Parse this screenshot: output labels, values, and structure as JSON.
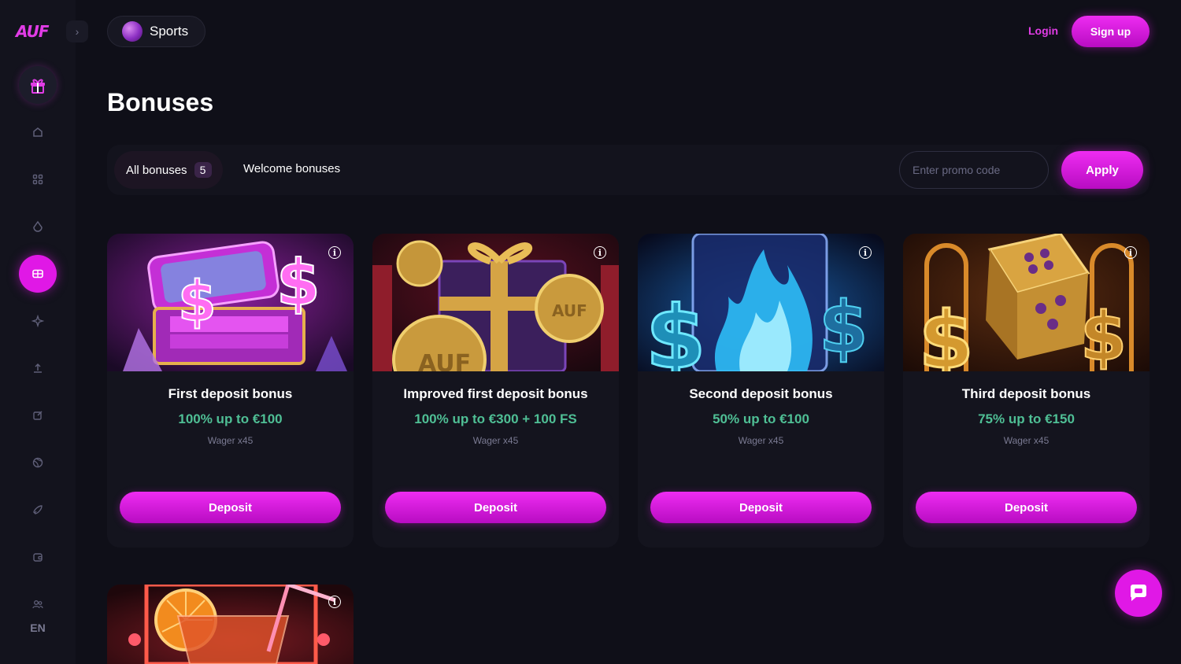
{
  "brand": {
    "logo_text": "AUF",
    "accent": "#e018e6",
    "amount_color": "#4fbf95"
  },
  "sidebar": {
    "items": [
      {
        "icon": "home-icon"
      },
      {
        "icon": "grid-icon"
      },
      {
        "icon": "drop-icon"
      },
      {
        "icon": "ticket-icon",
        "active": true
      },
      {
        "icon": "sparkle-icon"
      },
      {
        "icon": "upload-icon"
      },
      {
        "icon": "edit-icon"
      },
      {
        "icon": "ball-icon"
      },
      {
        "icon": "rocket-icon"
      },
      {
        "icon": "wallet-icon"
      },
      {
        "icon": "users-icon"
      }
    ],
    "language": "EN"
  },
  "header": {
    "sports_label": "Sports",
    "login_label": "Login",
    "signup_label": "Sign up"
  },
  "page": {
    "title": "Bonuses"
  },
  "filters": {
    "tabs": [
      {
        "label": "All bonuses",
        "count": "5",
        "active": true
      },
      {
        "label": "Welcome bonuses"
      }
    ],
    "promo_placeholder": "Enter promo code",
    "apply_label": "Apply"
  },
  "bonuses": [
    {
      "title": "First deposit bonus",
      "amount": "100% up to €100",
      "wager": "Wager x45",
      "button": "Deposit"
    },
    {
      "title": "Improved first deposit bonus",
      "amount": "100% up to €300 + 100 FS",
      "wager": "Wager x45",
      "button": "Deposit"
    },
    {
      "title": "Second deposit bonus",
      "amount": "50% up to €100",
      "wager": "Wager x45",
      "button": "Deposit"
    },
    {
      "title": "Third deposit bonus",
      "amount": "75% up to €150",
      "wager": "Wager x45",
      "button": "Deposit"
    }
  ]
}
